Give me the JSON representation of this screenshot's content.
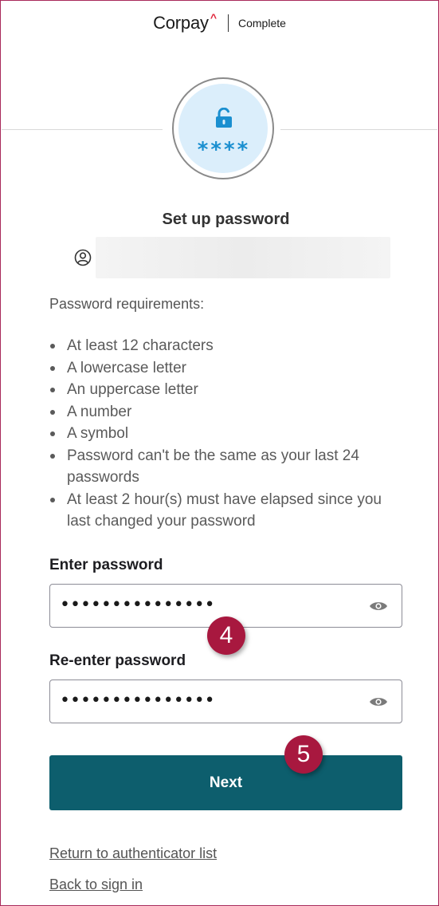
{
  "header": {
    "brand": "Corpay",
    "brand_caret": "^",
    "product": "Complete"
  },
  "badge": {
    "icon": "lock-icon",
    "stars": "****"
  },
  "title": "Set up password",
  "user": {
    "icon": "user-icon"
  },
  "requirements": {
    "heading": "Password requirements:",
    "items": [
      "At least 12 characters",
      "A lowercase letter",
      "An uppercase letter",
      "A number",
      "A symbol",
      "Password can't be the same as your last 24 passwords",
      "At least 2 hour(s) must have elapsed since you last changed your password"
    ]
  },
  "fields": {
    "password": {
      "label": "Enter password",
      "value": "•••••••••••••••",
      "icon": "eye-icon"
    },
    "confirm": {
      "label": "Re-enter password",
      "value": "•••••••••••••••",
      "icon": "eye-icon"
    }
  },
  "callouts": {
    "step4": "4",
    "step5": "5"
  },
  "actions": {
    "next": "Next",
    "return_link": "Return to authenticator list",
    "back_link": "Back to sign in"
  },
  "colors": {
    "primary_button": "#0d5e6d",
    "callout": "#a8183f",
    "frame_border": "#a8295a",
    "badge_fill": "#dbeefb",
    "badge_icon": "#1a8fd0"
  }
}
